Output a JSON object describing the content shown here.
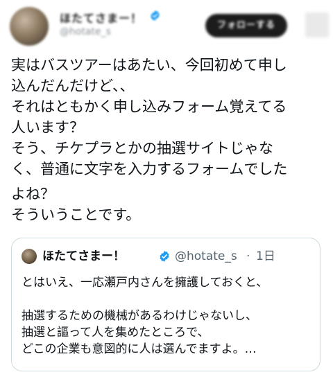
{
  "header": {
    "display_name": "ほたてさまー！",
    "handle": "@hotate_s",
    "follow_label": "フォローする"
  },
  "tweet": {
    "lines": [
      "実はバスツアーはあたい、今回初めて申し",
      "込んだんだけど、、",
      "それはともかく申し込みフォーム覚えてる",
      "人います？",
      "そう、チケプラとかの抽選サイトじゃな",
      "く、普通に文字を入力するフォームでした",
      "よね？",
      "そういうことです。"
    ]
  },
  "quote": {
    "display_name": "ほたてさまー！",
    "handle": "@hotate_s",
    "separator": "·",
    "time": "1日",
    "lines": [
      "とはいえ、一応瀬戸内さんを擁護しておくと、",
      "",
      "抽選するための機械があるわけじゃないし、",
      "抽選と謳って人を集めたところで、",
      "どこの企業も意図的に人は選んでますよ。…"
    ]
  },
  "colors": {
    "text": "#0f1419",
    "secondary_text": "#536471",
    "verified": "#1d9bf0",
    "border": "#cfd9de"
  },
  "icons": {
    "verified": "verified-badge-icon",
    "more": "more-icon"
  }
}
